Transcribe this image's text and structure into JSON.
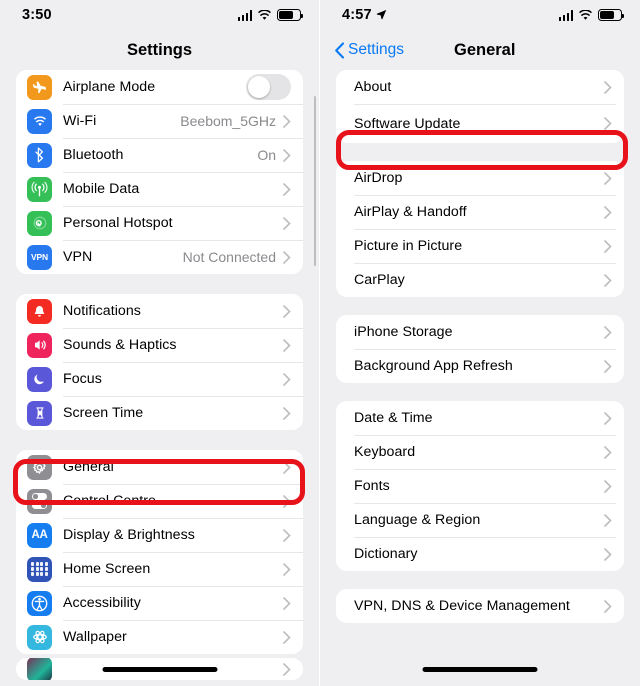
{
  "left_phone": {
    "status_bar": {
      "time": "3:50",
      "icons": [
        "signal-bars-icon",
        "wifi-icon",
        "battery-icon"
      ],
      "battery_level_pct": 70
    },
    "nav": {
      "title": "Settings"
    },
    "groups": [
      {
        "rows": [
          {
            "label": "Airplane Mode",
            "icon": "airplane-icon",
            "icon_color": "#f2991d",
            "glyph": "✈",
            "control": "toggle",
            "toggle_on": false
          },
          {
            "label": "Wi-Fi",
            "icon": "wifi-icon",
            "icon_color": "#2878f0",
            "glyph": "⇪",
            "value": "Beebom_5GHz",
            "control": "chevron"
          },
          {
            "label": "Bluetooth",
            "icon": "bluetooth-icon",
            "icon_color": "#2878f0",
            "glyph": "ᛦ",
            "value": "On",
            "control": "chevron"
          },
          {
            "label": "Mobile Data",
            "icon": "mobile-data-icon",
            "icon_color": "#34c056",
            "glyph": "୧",
            "control": "chevron"
          },
          {
            "label": "Personal Hotspot",
            "icon": "personal-hotspot-icon",
            "icon_color": "#34c056",
            "glyph": "∞",
            "control": "chevron"
          },
          {
            "label": "VPN",
            "icon": "vpn-icon",
            "icon_color": "#2878f0",
            "glyph": "VPN",
            "value": "Not Connected",
            "control": "chevron"
          }
        ]
      },
      {
        "rows": [
          {
            "label": "Notifications",
            "icon": "bell-icon",
            "icon_color": "#f32b22",
            "glyph": "ὑ4",
            "control": "chevron"
          },
          {
            "label": "Sounds & Haptics",
            "icon": "speaker-icon",
            "icon_color": "#f0245c",
            "glyph": "ὐA",
            "control": "chevron"
          },
          {
            "label": "Focus",
            "icon": "moon-icon",
            "icon_color": "#5a57d8",
            "glyph": "☽",
            "control": "chevron"
          },
          {
            "label": "Screen Time",
            "icon": "hourglass-icon",
            "icon_color": "#5a57d8",
            "glyph": "⌛",
            "control": "chevron"
          }
        ]
      },
      {
        "rows": [
          {
            "label": "General",
            "icon": "gear-icon",
            "icon_color": "#8e8e93",
            "glyph": "⚙",
            "control": "chevron",
            "highlighted": true
          },
          {
            "label": "Control Centre",
            "icon": "control-centre-icon",
            "icon_color": "#8e8e93",
            "glyph": "toggles",
            "control": "chevron"
          },
          {
            "label": "Display & Brightness",
            "icon": "display-brightness-icon",
            "icon_color": "#157df0",
            "glyph": "AA",
            "control": "chevron"
          },
          {
            "label": "Home Screen",
            "icon": "home-screen-icon",
            "icon_color": "#3053b8",
            "glyph": "grid",
            "control": "chevron"
          },
          {
            "label": "Accessibility",
            "icon": "accessibility-icon",
            "icon_color": "#157df0",
            "glyph": "⛹",
            "control": "chevron"
          },
          {
            "label": "Wallpaper",
            "icon": "wallpaper-icon",
            "icon_color": "#35b8e0",
            "glyph": "✻",
            "control": "chevron"
          }
        ]
      },
      {
        "clipped": true,
        "rows": [
          {
            "label": "",
            "icon": "siri-icon",
            "icon_color": "#1d3042",
            "glyph": "",
            "control": "chevron"
          }
        ]
      }
    ],
    "highlight_label": "General"
  },
  "right_phone": {
    "status_bar": {
      "time": "4:57",
      "icons": [
        "location-arrow-icon",
        "signal-bars-icon",
        "wifi-icon",
        "battery-icon"
      ],
      "battery_level_pct": 70
    },
    "nav": {
      "back_label": "Settings",
      "title": "General"
    },
    "groups": [
      {
        "rows": [
          {
            "label": "About",
            "control": "chevron"
          },
          {
            "label": "Software Update",
            "control": "chevron",
            "highlighted": true
          }
        ]
      },
      {
        "rows": [
          {
            "label": "AirDrop",
            "control": "chevron"
          },
          {
            "label": "AirPlay & Handoff",
            "control": "chevron"
          },
          {
            "label": "Picture in Picture",
            "control": "chevron"
          },
          {
            "label": "CarPlay",
            "control": "chevron"
          }
        ]
      },
      {
        "rows": [
          {
            "label": "iPhone Storage",
            "control": "chevron"
          },
          {
            "label": "Background App Refresh",
            "control": "chevron"
          }
        ]
      },
      {
        "rows": [
          {
            "label": "Date & Time",
            "control": "chevron"
          },
          {
            "label": "Keyboard",
            "control": "chevron"
          },
          {
            "label": "Fonts",
            "control": "chevron"
          },
          {
            "label": "Language & Region",
            "control": "chevron"
          },
          {
            "label": "Dictionary",
            "control": "chevron"
          }
        ]
      },
      {
        "rows": [
          {
            "label": "VPN, DNS & Device Management",
            "control": "chevron"
          }
        ]
      }
    ],
    "highlight_label": "Software Update"
  },
  "theme": {
    "background": "#efeff1",
    "card": "#ffffff",
    "accent_blue": "#0a79f4",
    "highlight_red": "#e8131a",
    "secondary_text": "#8a8a8e"
  }
}
